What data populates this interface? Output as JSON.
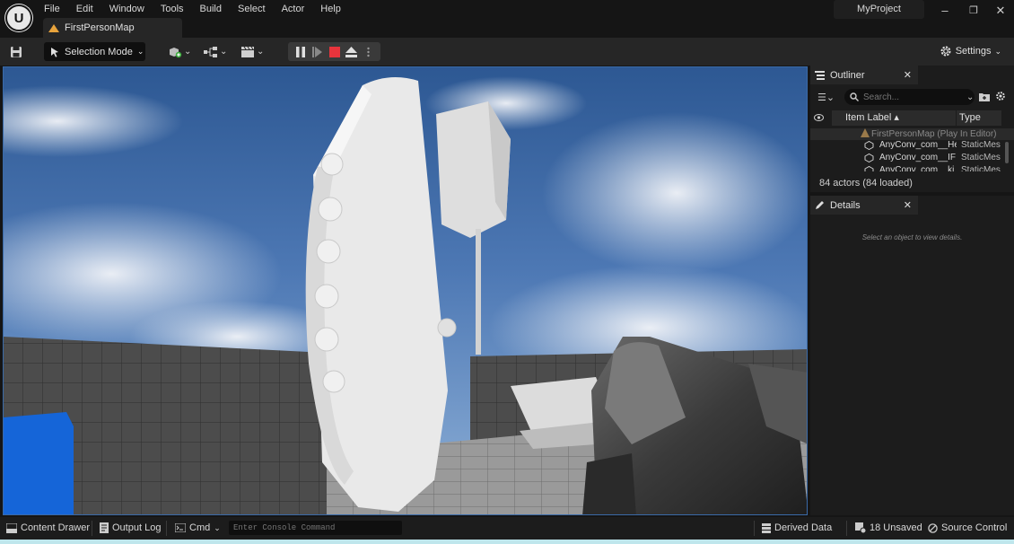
{
  "app": {
    "logo_text": "U",
    "project_name": "MyProject"
  },
  "menu": [
    "File",
    "Edit",
    "Window",
    "Tools",
    "Build",
    "Select",
    "Actor",
    "Help"
  ],
  "document_tab": {
    "label": "FirstPersonMap"
  },
  "window_controls": {
    "minimize": "–",
    "maximize": "❐",
    "close": "✕"
  },
  "toolbar": {
    "selection_mode_label": "Selection Mode",
    "settings_label": "Settings",
    "play_controls": [
      "pause-icon",
      "step-icon",
      "stop-icon",
      "eject-icon",
      "more-icon"
    ]
  },
  "outliner": {
    "tab_label": "Outliner",
    "search_placeholder": "Search...",
    "col_label": "Item Label",
    "col_type": "Type",
    "world_row": "FirstPersonMap (Play In Editor)",
    "rows": [
      {
        "label": "AnyConv_com__He",
        "type": "StaticMes"
      },
      {
        "label": "AnyConv_com__IF",
        "type": "StaticMes"
      },
      {
        "label": "AnyConv_com__ki",
        "type": "StaticMes"
      }
    ],
    "actor_count": "84 actors (84 loaded)"
  },
  "details": {
    "tab_label": "Details",
    "empty_message": "Select an object to view details."
  },
  "statusbar": {
    "content_drawer": "Content Drawer",
    "output_log": "Output Log",
    "cmd": "Cmd",
    "console_placeholder": "Enter Console Command",
    "derived_data": "Derived Data",
    "unsaved": "18 Unsaved",
    "source_control": "Source Control"
  },
  "colors": {
    "accent_play_stop": "#e8343c",
    "map_icon": "#e8a33c",
    "viewport_border": "#3a6aa8",
    "sky_top": "#2f5a96"
  }
}
